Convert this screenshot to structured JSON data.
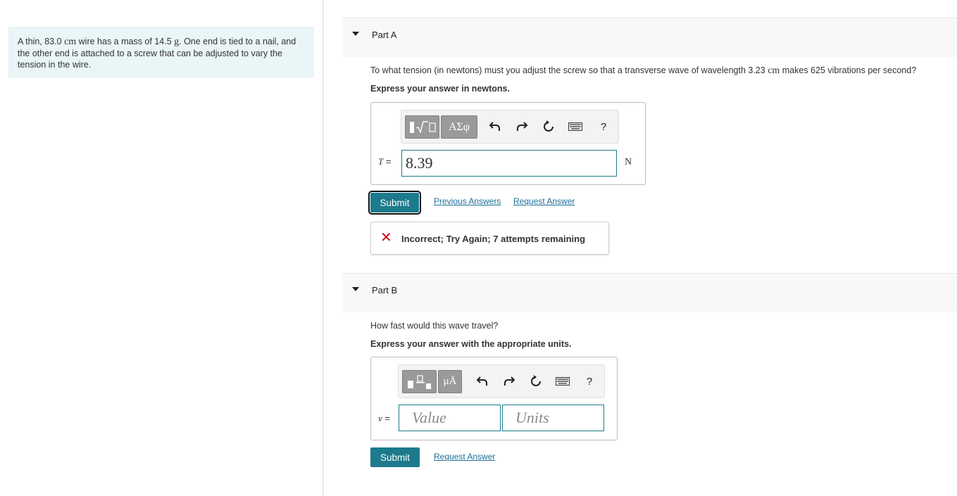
{
  "problem": {
    "text_before_length": "A thin, ",
    "length": "83.0",
    "length_unit": "cm",
    "text_mass_1": " wire has a mass of 14.5 ",
    "mass_unit": "g",
    "text_after": ". One end is tied to a nail, and the other end is attached to a screw that can be adjusted to vary the tension in the wire."
  },
  "part_a": {
    "title": "Part A",
    "question_before": "To what tension (in newtons) must you adjust the screw so that a transverse wave of wavelength 3.23 ",
    "wavelength_unit": "cm",
    "question_after": " makes 625 vibrations per second?",
    "instruction": "Express your answer in newtons.",
    "toolbar": {
      "template_button_icon": "radical-template-icon",
      "greek_button_label": "ΑΣφ",
      "undo_icon": "undo-icon",
      "redo_icon": "redo-icon",
      "reset_icon": "reset-icon",
      "keyboard_icon": "keyboard-icon",
      "help_label": "?"
    },
    "variable": "T",
    "equals": " =",
    "answer_value": "8.39",
    "unit": "N",
    "submit_label": "Submit",
    "previous_answers_label": "Previous Answers",
    "request_answer_label": "Request Answer",
    "feedback": {
      "icon": "x-icon",
      "icon_color": "#d0021b",
      "message": "Incorrect; Try Again; 7 attempts remaining"
    }
  },
  "part_b": {
    "title": "Part B",
    "question": "How fast would this wave travel?",
    "instruction": "Express your answer with the appropriate units.",
    "toolbar": {
      "template_button_icon": "units-template-icon",
      "units_button_label": "μÅ",
      "undo_icon": "undo-icon",
      "redo_icon": "redo-icon",
      "reset_icon": "reset-icon",
      "keyboard_icon": "keyboard-icon",
      "help_label": "?"
    },
    "variable": "v",
    "equals": " =",
    "value_placeholder": "Value",
    "units_placeholder": "Units",
    "submit_label": "Submit",
    "request_answer_label": "Request Answer"
  },
  "colors": {
    "accent": "#1c7a8c",
    "problem_background": "#e9f5f6",
    "link": "#1c6e97"
  }
}
